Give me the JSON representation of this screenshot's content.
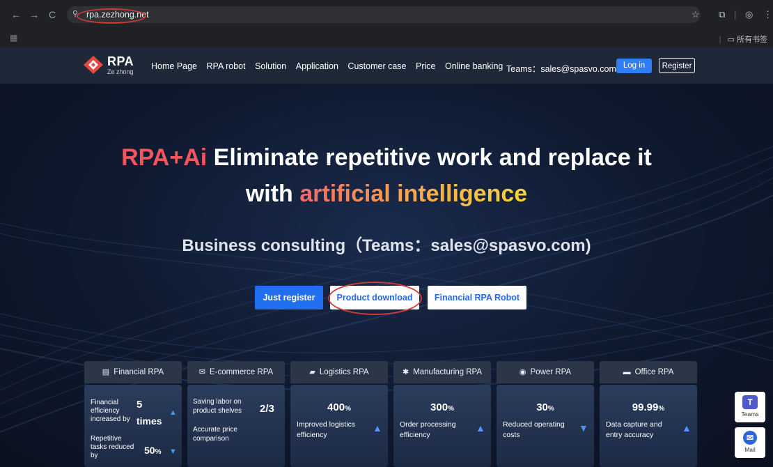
{
  "browser": {
    "back_icon": "←",
    "forward_icon": "→",
    "reload_icon": "C",
    "url": "rpa.zezhong.net",
    "star_icon": "☆",
    "all_bookmarks_label": "所有书签"
  },
  "header": {
    "logo_text": "RPA",
    "logo_sub": "Ze zhong",
    "nav_items": [
      "Home Page",
      "RPA robot",
      "Solution",
      "Application",
      "Customer case",
      "Price",
      "Online banking"
    ],
    "teams_contact": "Teams：sales@spasvo.com",
    "login_label": "Log in",
    "register_label": "Register"
  },
  "hero": {
    "title_prefix": "RPA+Ai",
    "title_line1": " Eliminate repetitive work and replace it",
    "title_line2_prefix": "with ",
    "title_highlight": "artificial intelligence",
    "subtitle": "Business consulting（Teams：sales@spasvo.com)",
    "cta_register": "Just register",
    "cta_download": "Product download",
    "cta_financial": "Financial RPA Robot"
  },
  "categories": [
    {
      "label": "Financial RPA",
      "icon": "document-icon"
    },
    {
      "label": "E-commerce RPA",
      "icon": "mail-icon"
    },
    {
      "label": "Logistics RPA",
      "icon": "truck-icon"
    },
    {
      "label": "Manufacturing RPA",
      "icon": "gear-icon"
    },
    {
      "label": "Power RPA",
      "icon": "power-icon"
    },
    {
      "label": "Office RPA",
      "icon": "monitor-icon"
    }
  ],
  "cards": {
    "financial": {
      "line1": "Financial efficiency increased by",
      "num1": "5",
      "times": "times",
      "line2": "Repetitive tasks reduced by",
      "num2": "50",
      "unit2": "%"
    },
    "ecommerce": {
      "line1": "Saving labor on product shelves",
      "num": "2/3",
      "line2": "Accurate price comparison"
    },
    "logistics": {
      "value": "400",
      "unit": "%",
      "desc": "Improved logistics efficiency"
    },
    "manufacturing": {
      "value": "300",
      "unit": "%",
      "desc": "Order processing efficiency"
    },
    "power": {
      "value": "30",
      "unit": "%",
      "desc": "Reduced operating costs"
    },
    "office": {
      "value": "99.99",
      "unit": "%",
      "desc": "Data capture and entry accuracy"
    }
  },
  "floating": {
    "teams_label": "Teams",
    "mail_label": "Mail"
  },
  "colors": {
    "accent_blue": "#1f6ff0",
    "highlight_red": "#f2555e",
    "annotation_red": "#d23a35"
  }
}
